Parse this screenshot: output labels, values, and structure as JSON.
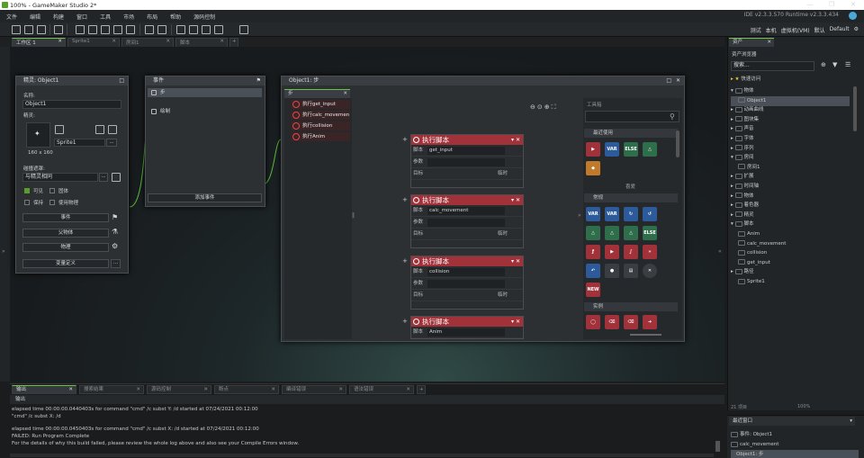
{
  "titlebar": {
    "title": "100% - GameMaker Studio 2*"
  },
  "menu": [
    "文件",
    "编辑",
    "构建",
    "窗口",
    "工具",
    "市场",
    "布局",
    "帮助",
    "源码控制"
  ],
  "version": "IDE v2.3.3.570  Runtime v2.3.3.434",
  "topright": [
    "测试",
    "本机",
    "虚拟机(VM)",
    "默认",
    "Default"
  ],
  "tabs": [
    {
      "label": "工作区 1",
      "active": true
    },
    {
      "label": "Sprite1"
    },
    {
      "label": "房间1"
    },
    {
      "label": "脚本"
    }
  ],
  "sprite_win": {
    "title": "精灵: Object1",
    "name_label": "名称:",
    "name": "Object1",
    "sprite_label": "精灵:",
    "sprite": "Sprite1",
    "size": "160 x 160",
    "collision_label": "碰撞遮罩:",
    "collision": "与精灵相同",
    "visible": "可见",
    "solid": "固体",
    "persistent": "保持",
    "physics": "使用物理",
    "events_btn": "事件",
    "parent_btn": "父物体",
    "physics_btn": "物理",
    "vars_btn": "变量定义"
  },
  "events_win": {
    "title": "事件",
    "items": [
      "步",
      "绘制"
    ],
    "add_btn": "添加事件"
  },
  "object_win": {
    "title": "Object1: 步",
    "subtab": "步",
    "actions": [
      "执行get_input",
      "执行calc_movemen",
      "执行collision",
      "执行Anim"
    ],
    "block_title": "执行脚本",
    "blocks": [
      {
        "script": "get_input"
      },
      {
        "script": "calc_movement"
      },
      {
        "script": "collision"
      },
      {
        "script": "Anim"
      }
    ],
    "row_script": "脚本",
    "row_args": "参数",
    "row_target": "目标",
    "row_temp": "临时",
    "toolbox_label": "工具箱",
    "recent_label": "最近使用",
    "favorites_label": "喜爱",
    "common_label": "常规",
    "instance_label": "实例"
  },
  "assets": {
    "title": "资产",
    "subtitle": "资产浏览器",
    "search_placeholder": "搜索...",
    "quick": "快速访问",
    "tree": [
      {
        "label": "物体",
        "lvl": 0,
        "open": true
      },
      {
        "label": "Object1",
        "lvl": 1,
        "sel": true
      },
      {
        "label": "动画曲线",
        "lvl": 0
      },
      {
        "label": "图块集",
        "lvl": 0
      },
      {
        "label": "声音",
        "lvl": 0
      },
      {
        "label": "字体",
        "lvl": 0
      },
      {
        "label": "序列",
        "lvl": 0
      },
      {
        "label": "房间",
        "lvl": 0,
        "open": true
      },
      {
        "label": "房间1",
        "lvl": 1
      },
      {
        "label": "扩展",
        "lvl": 0
      },
      {
        "label": "时间轴",
        "lvl": 0
      },
      {
        "label": "物体",
        "lvl": 0
      },
      {
        "label": "着色器",
        "lvl": 0
      },
      {
        "label": "精灵",
        "lvl": 0
      },
      {
        "label": "脚本",
        "lvl": 0,
        "open": true
      },
      {
        "label": "Anim",
        "lvl": 1
      },
      {
        "label": "calc_movement",
        "lvl": 1
      },
      {
        "label": "collision",
        "lvl": 1
      },
      {
        "label": "get_input",
        "lvl": 1
      },
      {
        "label": "路径",
        "lvl": 0
      },
      {
        "label": "Sprite1",
        "lvl": 1
      }
    ],
    "count": "21 项目",
    "zoom": "100%"
  },
  "recent": {
    "title": "最近窗口",
    "items": [
      "事件: Object1",
      "calc_movement",
      "Object1: 步"
    ]
  },
  "output": {
    "tabs": [
      "输出",
      "搜索结果",
      "源码控制",
      "断点",
      "编译错误",
      "语法错误"
    ],
    "label": "输出",
    "lines": [
      "elapsed time 00:00:00.0440403s for command \"cmd\" /c subst Y: /d started at 07/24/2021 00:12:00",
      "\"cmd\" /c subst X: /d",
      "elapsed time 00:00:00.0450403s for command \"cmd\" /c subst X: /d started at 07/24/2021 00:12:00",
      "FAILED: Run Program Complete",
      "For the details of why this build failed, please review the whole log above and also see your Compile Errors window."
    ]
  }
}
